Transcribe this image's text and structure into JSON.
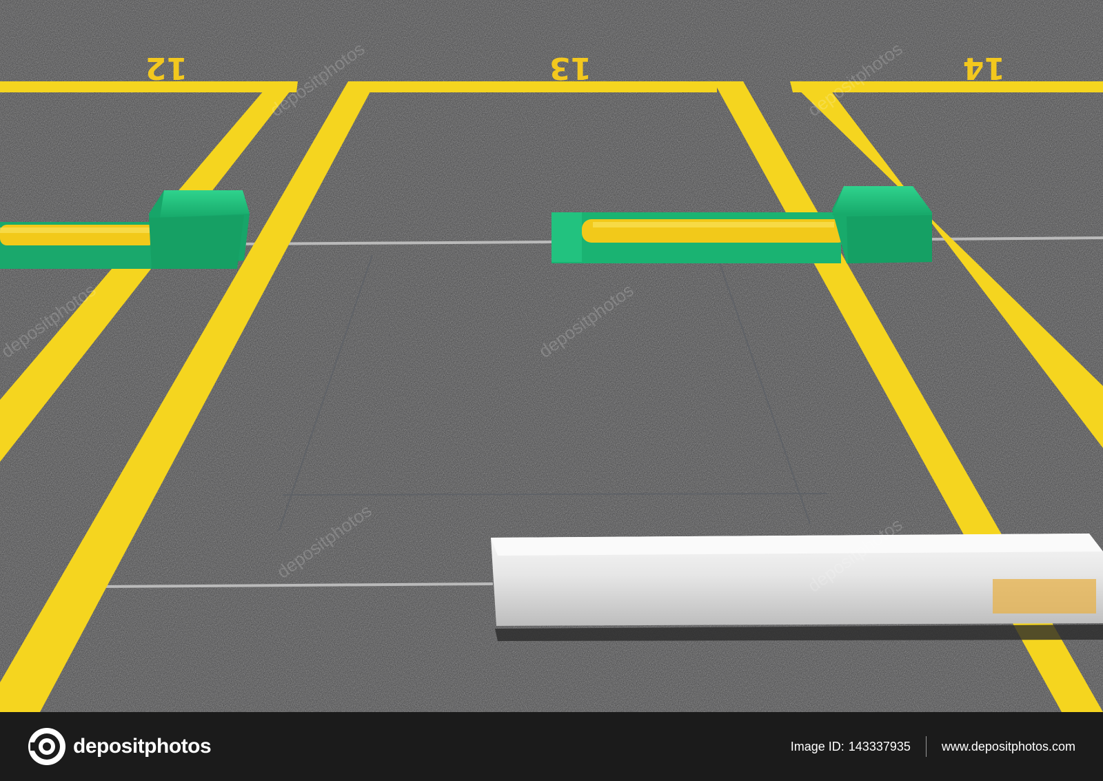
{
  "scene": {
    "description_colors": {
      "asphalt": "#3a3a3c",
      "line_yellow": "#f5d51f",
      "blocker_green": "#1fb577",
      "curb_white": "#ececec"
    },
    "space_numbers": [
      "12",
      "13",
      "14"
    ],
    "watermark_text": "depositphotos"
  },
  "footer": {
    "logo_text": "depositphotos",
    "image_id_label": "Image ID:",
    "image_id_value": "143337935",
    "website": "www.depositphotos.com"
  }
}
